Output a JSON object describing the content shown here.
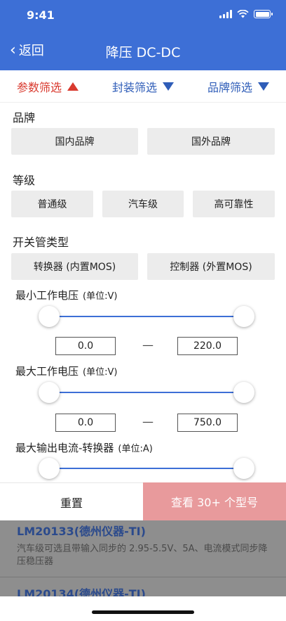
{
  "status": {
    "time": "9:41"
  },
  "nav": {
    "back_label": "返回",
    "title": "降压 DC-DC"
  },
  "filters": [
    {
      "label": "参数筛选",
      "active": true
    },
    {
      "label": "封装筛选",
      "active": false
    },
    {
      "label": "品牌筛选",
      "active": false
    }
  ],
  "brand": {
    "title": "品牌",
    "options": [
      "国内品牌",
      "国外品牌"
    ]
  },
  "grade": {
    "title": "等级",
    "options": [
      "普通级",
      "汽车级",
      "高可靠性"
    ]
  },
  "switch_type": {
    "title": "开关管类型",
    "options": [
      "转换器 (内置MOS)",
      "控制器 (外置MOS)"
    ]
  },
  "min_voltage": {
    "title": "最小工作电压",
    "unit": "(单位:V)",
    "min": "0.0",
    "max": "220.0",
    "dash": "—"
  },
  "max_voltage": {
    "title": "最大工作电压",
    "unit": "(单位:V)",
    "min": "0.0",
    "max": "750.0",
    "dash": "—"
  },
  "max_current": {
    "title": "最大输出电流-转换器",
    "unit": "(单位:A)"
  },
  "actions": {
    "reset": "重置",
    "view": "查看 30+ 个型号"
  },
  "results": [
    {
      "title": "LM20133(德州仪器-TI)",
      "desc": "汽车级可选且带输入同步的 2.95-5.5V、5A、电流模式同步降压稳压器"
    },
    {
      "title": "LM20134(德州仪器-TI)",
      "desc": ""
    }
  ],
  "colors": {
    "primary": "#3d6fd6",
    "active_tab": "#d93a2f",
    "view_button": "#e89a9c"
  }
}
